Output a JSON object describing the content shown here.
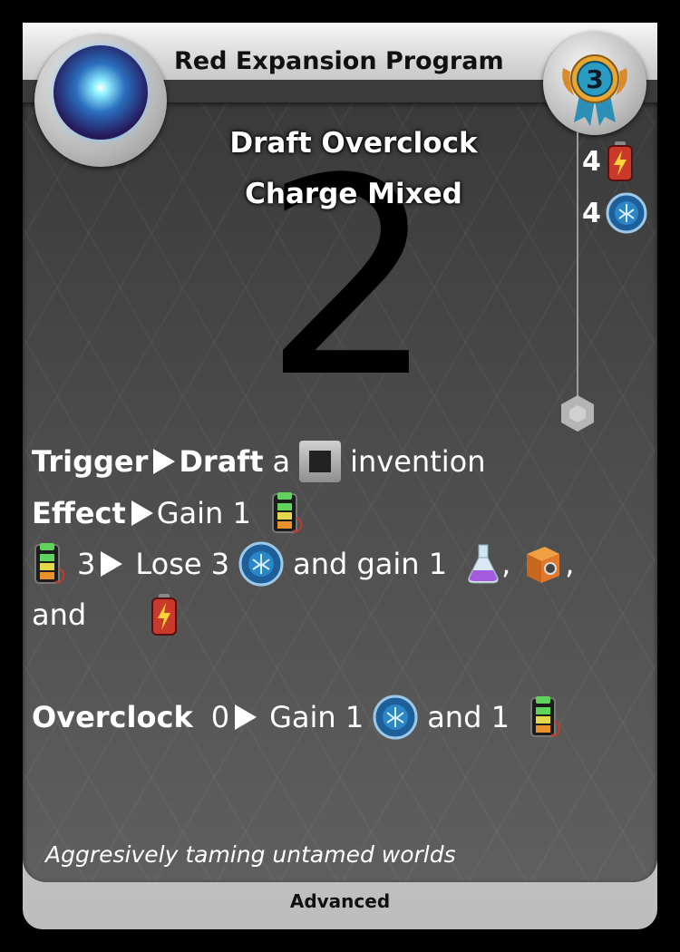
{
  "card": {
    "title": "Red Expansion Program",
    "tier": "3",
    "big_number": "2",
    "keywords": [
      "Draft  Overclock",
      "Charge  Mixed"
    ],
    "costs": [
      {
        "amount": "4",
        "icon": "battery-icon"
      },
      {
        "amount": "4",
        "icon": "blue-token-icon"
      }
    ],
    "rules": {
      "trigger_label": "Trigger",
      "trigger_keyword": "Draft",
      "trigger_a": "a",
      "trigger_object": "invention",
      "effect_label": "Effect",
      "effect_text": "Gain 1",
      "cond_amount": "3",
      "cond_lose": "Lose 3",
      "cond_and_gain": "and gain 1",
      "comma1": ",",
      "comma2": ",",
      "and_word": "and",
      "overclock_label": "Overclock",
      "overclock_amount": "0",
      "overclock_gain": "Gain 1",
      "overclock_and": "and 1"
    },
    "flavor": "Aggresively taming untamed worlds",
    "footer": "Advanced"
  },
  "colors": {
    "panel": "#4a4a4a",
    "frame": "#d6d6d6",
    "text": "#ffffff"
  }
}
